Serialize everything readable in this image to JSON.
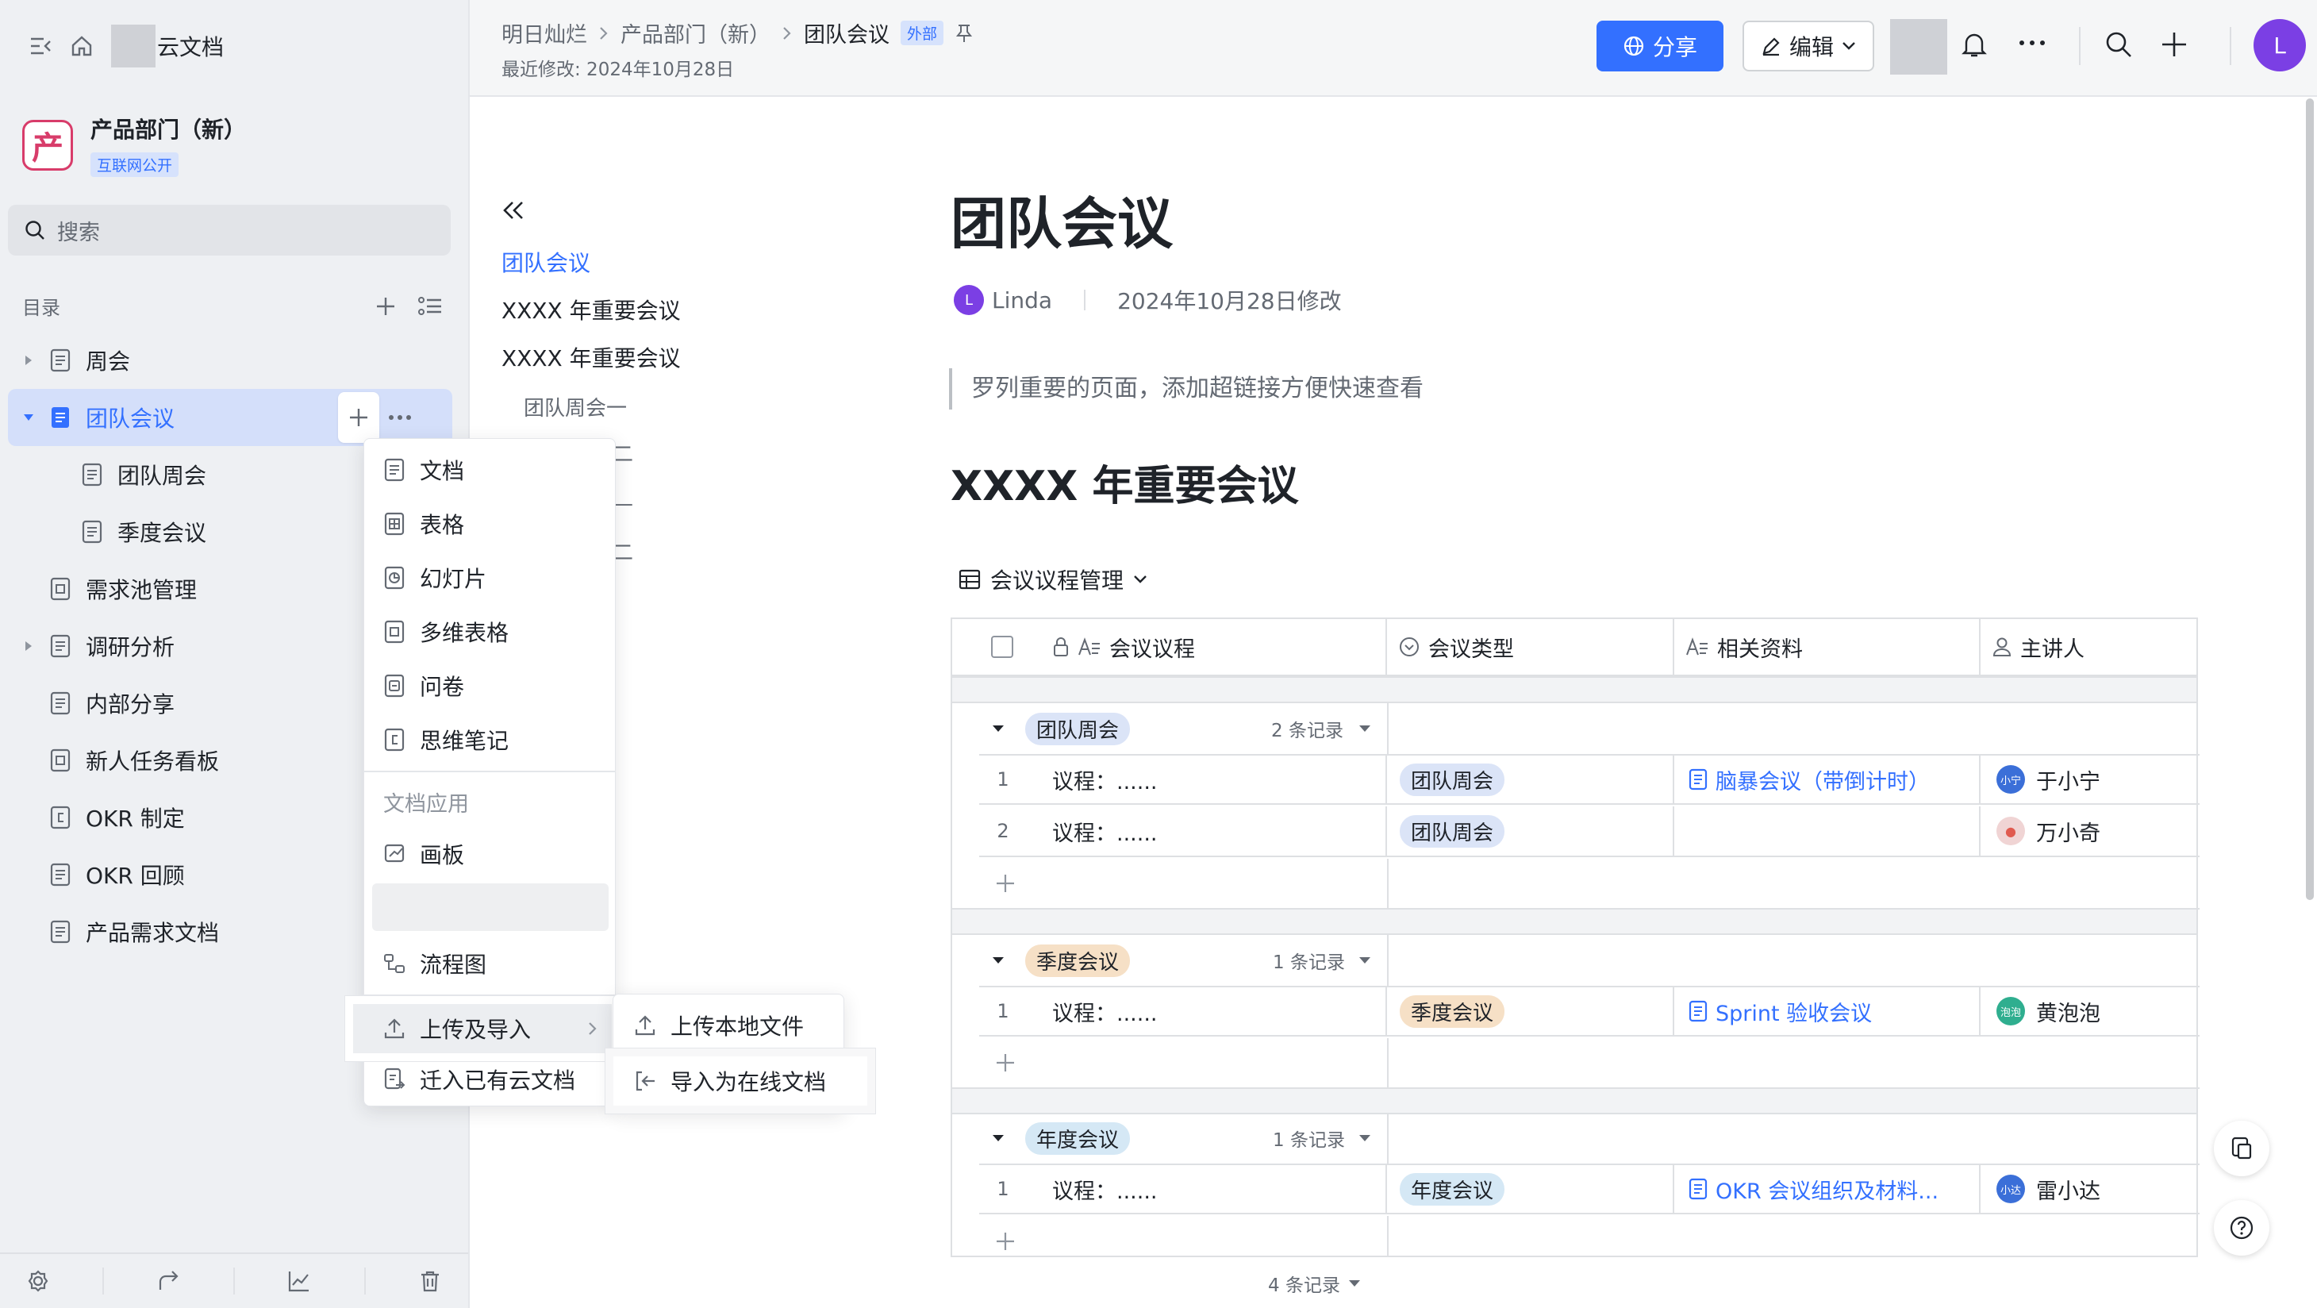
{
  "app": {
    "name": "云文档"
  },
  "workspace": {
    "logo_char": "产",
    "title": "产品部门（新）",
    "badge": "互联网公开"
  },
  "search": {
    "placeholder": "搜索"
  },
  "toc": {
    "label": "目录"
  },
  "tree": [
    {
      "label": "周会",
      "expandable": true
    },
    {
      "label": "团队会议",
      "active": true
    },
    {
      "label": "团队周会"
    },
    {
      "label": "季度会议"
    },
    {
      "label": "需求池管理"
    },
    {
      "label": "调研分析",
      "expandable": true
    },
    {
      "label": "内部分享"
    },
    {
      "label": "新人任务看板"
    },
    {
      "label": "OKR 制定"
    },
    {
      "label": "OKR 回顾"
    },
    {
      "label": "产品需求文档"
    }
  ],
  "header": {
    "breadcrumb": [
      "明日灿烂",
      "产品部门（新）",
      "团队会议"
    ],
    "ext_badge": "外部",
    "modified": "最近修改: 2024年10月28日",
    "share": "分享",
    "edit": "编辑",
    "user_initial": "L"
  },
  "outline": {
    "items": [
      "团队会议",
      "XXXX 年重要会议",
      "XXXX 年重要会议",
      "团队周会一",
      "二",
      "—",
      "二"
    ]
  },
  "doc": {
    "title": "团队会议",
    "author_initial": "L",
    "author": "Linda",
    "modified": "2024年10月28日修改",
    "quote": "罗列重要的页面，添加超链接方便快速查看",
    "h2": "XXXX 年重要会议",
    "view_name": "会议议程管理"
  },
  "table": {
    "columns": [
      "会议议程",
      "会议类型",
      "相关资料",
      "主讲人"
    ],
    "groups": [
      {
        "name": "团队周会",
        "count": "2 条记录",
        "color": "#dbe4f7",
        "rows": [
          {
            "n": "1",
            "agenda": "议程：......",
            "type": "团队周会",
            "doc": "脑暴会议（带倒计时）",
            "person": "于小宁",
            "avatar": "小宁",
            "av_color": "#3b6fd8"
          },
          {
            "n": "2",
            "agenda": "议程：......",
            "type": "团队周会",
            "doc": "",
            "person": "万小奇",
            "avatar": "●",
            "av_color": "#f0d4d4"
          }
        ]
      },
      {
        "name": "季度会议",
        "count": "1 条记录",
        "color": "#f6e0c6",
        "rows": [
          {
            "n": "1",
            "agenda": "议程：......",
            "type": "季度会议",
            "doc": "Sprint 验收会议",
            "person": "黄泡泡",
            "avatar": "泡泡",
            "av_color": "#2fae8f"
          }
        ]
      },
      {
        "name": "年度会议",
        "count": "1 条记录",
        "color": "#d5e8f5",
        "rows": [
          {
            "n": "1",
            "agenda": "议程：......",
            "type": "年度会议",
            "doc": "OKR 会议组织及材料...",
            "person": "雷小达",
            "avatar": "小达",
            "av_color": "#3b6fd8"
          }
        ]
      }
    ],
    "total": "4 条记录"
  },
  "menu": {
    "items": [
      "文档",
      "表格",
      "幻灯片",
      "多维表格",
      "问卷",
      "思维笔记"
    ],
    "section": "文档应用",
    "board": "画板",
    "flow": "流程图",
    "upload": "上传及导入",
    "migrate": "迁入已有云文档"
  },
  "submenu": {
    "items": [
      "上传本地文件",
      "导入为在线文档"
    ]
  }
}
